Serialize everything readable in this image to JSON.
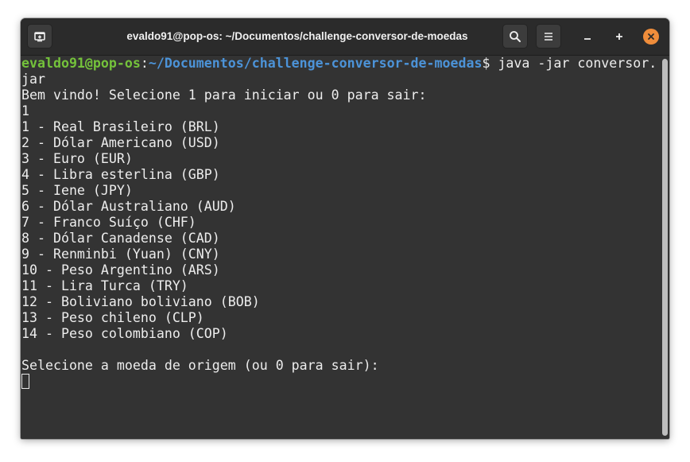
{
  "window": {
    "title": "evaldo91@pop-os: ~/Documentos/challenge-conversor-de-moedas"
  },
  "icons": {
    "new_tab": "new-tab-icon",
    "search": "search-icon",
    "menu": "hamburger-menu-icon",
    "minimize": "minimize-icon",
    "maximize": "maximize-icon",
    "close": "close-icon"
  },
  "colors": {
    "background": "#333333",
    "titlebar": "#2b2b2b",
    "prompt_user": "#74c23b",
    "prompt_path": "#4c93d8",
    "text": "#ededed",
    "close_button": "#ef8d3b"
  },
  "terminal": {
    "prompt_user": "evaldo91@pop-os",
    "prompt_colon": ":",
    "prompt_path": "~/Documentos/challenge-conversor-de-moedas",
    "prompt_symbol": "$ ",
    "command": "java -jar conversor.",
    "command_wrap": "jar",
    "welcome": "Bem vindo! Selecione 1 para iniciar ou 0 para sair:",
    "user_input": "1",
    "currencies": [
      "1 - Real Brasileiro (BRL)",
      "2 - Dólar Americano (USD)",
      "3 - Euro (EUR)",
      "4 - Libra esterlina (GBP)",
      "5 - Iene (JPY)",
      "6 - Dólar Australiano (AUD)",
      "7 - Franco Suíço (CHF)",
      "8 - Dólar Canadense (CAD)",
      "9 - Renminbi (Yuan) (CNY)",
      "10 - Peso Argentino (ARS)",
      "11 - Lira Turca (TRY)",
      "12 - Boliviano boliviano (BOB)",
      "13 - Peso chileno (CLP)",
      "14 - Peso colombiano (COP)"
    ],
    "blank": "",
    "select_prompt": "Selecione a moeda de origem (ou 0 para sair):"
  }
}
